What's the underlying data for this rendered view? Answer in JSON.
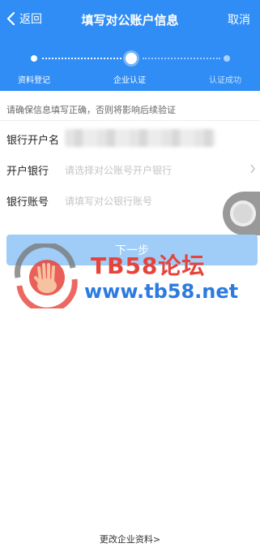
{
  "nav": {
    "back_label": "返回",
    "title": "填写对公账户信息",
    "cancel_label": "取消"
  },
  "steps": [
    {
      "label": "资料登记",
      "state": "done"
    },
    {
      "label": "企业认证",
      "state": "active"
    },
    {
      "label": "认证成功",
      "state": "pending"
    }
  ],
  "form": {
    "tip": "请确保信息填写正确，否则将影响后续验证",
    "fields": [
      {
        "label": "银行开户名",
        "value": "",
        "blurred": true
      },
      {
        "label": "开户银行",
        "placeholder": "请选择对公账号开户银行"
      },
      {
        "label": "银行账号",
        "placeholder": "请填写对公银行账号"
      }
    ]
  },
  "next_button_label": "下一步",
  "footer_link": "更改企业资料>",
  "watermark": {
    "line1": "TB58论坛",
    "line2": "www.tb58.net"
  },
  "colors": {
    "header_blue": "#2f8df5",
    "button_disabled": "#9fcdf7",
    "watermark_red": "#e6433a",
    "watermark_blue": "#2c7be0"
  }
}
